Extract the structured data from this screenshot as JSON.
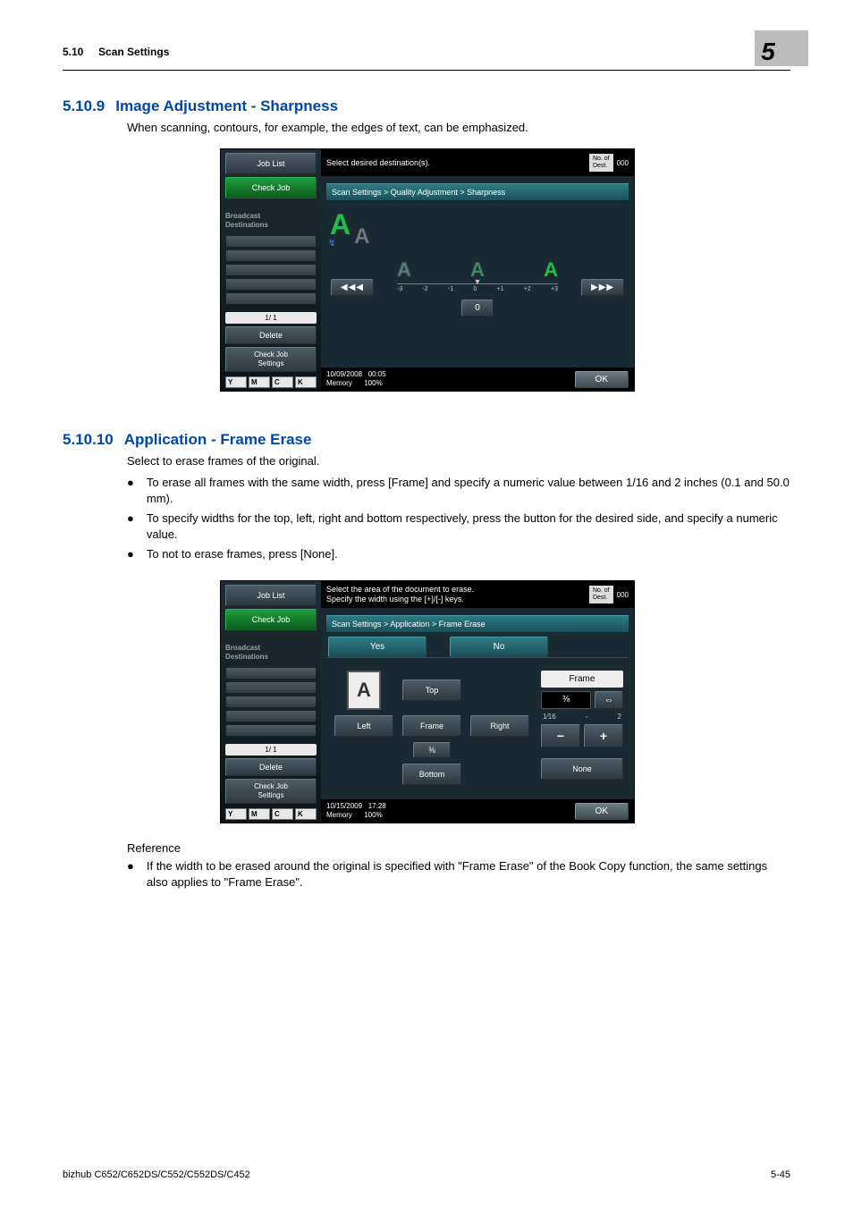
{
  "header": {
    "section_num": "5.10",
    "section_title": "Scan Settings",
    "chapter_num": "5"
  },
  "section1": {
    "num": "5.10.9",
    "title": "Image Adjustment - Sharpness",
    "intro": "When scanning, contours, for example, the edges of text, can be emphasized."
  },
  "section2": {
    "num": "5.10.10",
    "title": "Application - Frame Erase",
    "intro": "Select to erase frames of the original.",
    "bullets": [
      "To erase all frames with the same width, press [Frame] and specify a numeric value between 1/16 and 2 inches (0.1 and 50.0 mm).",
      "To specify widths for the top, left, right and bottom respectively, press the button for the desired side, and specify a numeric value.",
      "To not to erase frames, press [None]."
    ],
    "ref_label": "Reference",
    "ref_bullets": [
      "If the width to be erased around the original is specified with \"Frame Erase\" of the Book Copy function, the same settings also applies to \"Frame Erase\"."
    ]
  },
  "mfp_common": {
    "job_list": "Job List",
    "check_job": "Check Job",
    "broadcast": "Broadcast\nDestinations",
    "page_indicator": "1/  1",
    "delete": "Delete",
    "check_job_settings": "Check Job\nSettings",
    "no_of_dest": "No. of\nDest.",
    "dest_count": "000",
    "ok": "OK",
    "toners": [
      "Y",
      "M",
      "C",
      "K"
    ],
    "toner_colors": [
      "#f2d100",
      "#d93a8a",
      "#00a0d9",
      "#000000"
    ]
  },
  "mfp1": {
    "message": "Select desired destination(s).",
    "crumb": "Scan Settings > Quality Adjustment > Sharpness",
    "scale_labels": [
      "-3",
      "-2",
      "-1",
      "0",
      "+1",
      "+2",
      "+3"
    ],
    "value": "0",
    "left_arrows": "◀◀◀",
    "right_arrows": "▶▶▶",
    "date": "10/09/2008",
    "time": "00:05",
    "mem_label": "Memory",
    "mem_val": "100%"
  },
  "mfp2": {
    "message": "Select the area of the document to erase.\nSpecify the width using the [+]/[-] keys.",
    "crumb": "Scan Settings > Application > Frame Erase",
    "yes": "Yes",
    "no": "No",
    "top": "Top",
    "left": "Left",
    "frame": "Frame",
    "right": "Right",
    "bottom": "Bottom",
    "side_label": "Frame",
    "value": "⅜",
    "swap": "⇔",
    "range_min": "1⁄16",
    "range_dash": "-",
    "range_max": "2",
    "minus": "−",
    "plus": "+",
    "none": "None",
    "date": "10/15/2009",
    "time": "17:28",
    "mem_label": "Memory",
    "mem_val": "100%"
  },
  "footer": {
    "model": "bizhub C652/C652DS/C552/C552DS/C452",
    "page": "5-45"
  }
}
